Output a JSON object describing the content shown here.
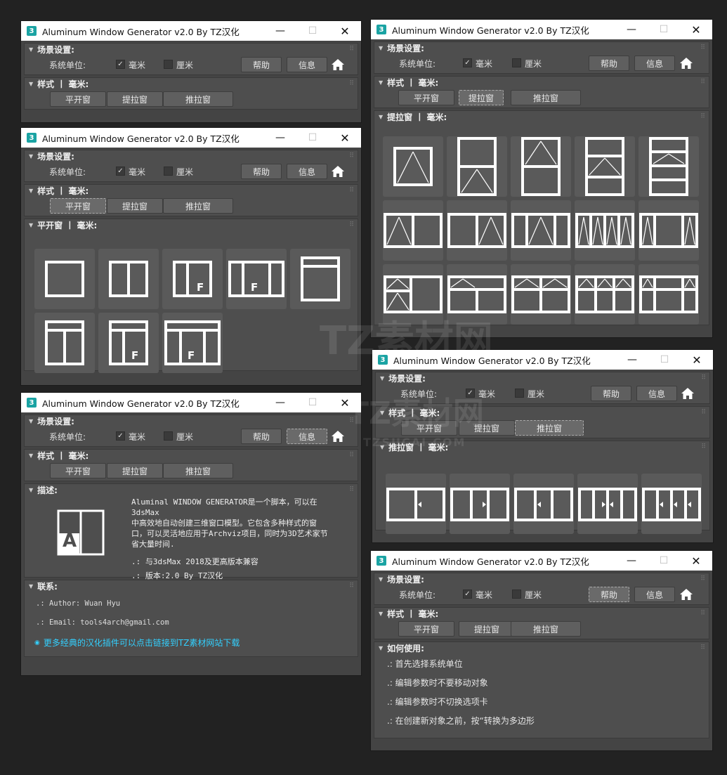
{
  "common": {
    "title": "Aluminum Window Generator v2.0 By TZ汉化",
    "app_icon_text": "3",
    "minimize_glyph": "—",
    "maximize_glyph": "☐",
    "close_glyph": "✕",
    "scene_header": "场景设置:",
    "unit_label": "系统单位:",
    "unit_mm": "毫米",
    "unit_cm": "厘米",
    "mm_checked": true,
    "help_button": "帮助",
    "info_button": "信息",
    "style_header": "样式  丨 毫米:",
    "style_buttons": [
      "平开窗",
      "提拉窗",
      "推拉窗"
    ],
    "home_icon": "home-icon"
  },
  "casement_panel": {
    "header": "平开窗  丨 毫米:"
  },
  "hung_panel": {
    "header": "提拉窗  丨 毫米:"
  },
  "sliding_panel": {
    "header": "推拉窗  丨 毫米:"
  },
  "about_panel": {
    "desc_header": "描述:",
    "desc_lines": [
      "Aluminal WINDOW GENERATOR是一个脚本，可以在3dsMax",
      "中高效地自动创建三维窗口模型。它包含多种样式的窗",
      "口，可以灵活地应用于Archviz项目，同时为3D艺术家节",
      "省大量时间."
    ],
    "compat": ".: 与3dsMax 2018及更高版本兼容",
    "version": ".: 版本:2.0 By TZ汉化",
    "logo_letter": "A",
    "contact_header": "联系:",
    "author": ".: Author: Wuan Hyu",
    "email": ".: Email: tools4arch@gmail.com",
    "link_text": "更多经典的汉化插件可以点击链接到TZ素材网站下载"
  },
  "howto_panel": {
    "header": "如何使用:",
    "items": [
      ".: 首先选择系统单位",
      ".: 编辑参数时不要移动对象",
      ".: 编辑参数时不切换选项卡",
      ".: 在创建新对象之前，按“转换为多边形"
    ]
  },
  "watermark": {
    "brand": "TZ素材网",
    "domain": "TZSUCAI.COM"
  }
}
